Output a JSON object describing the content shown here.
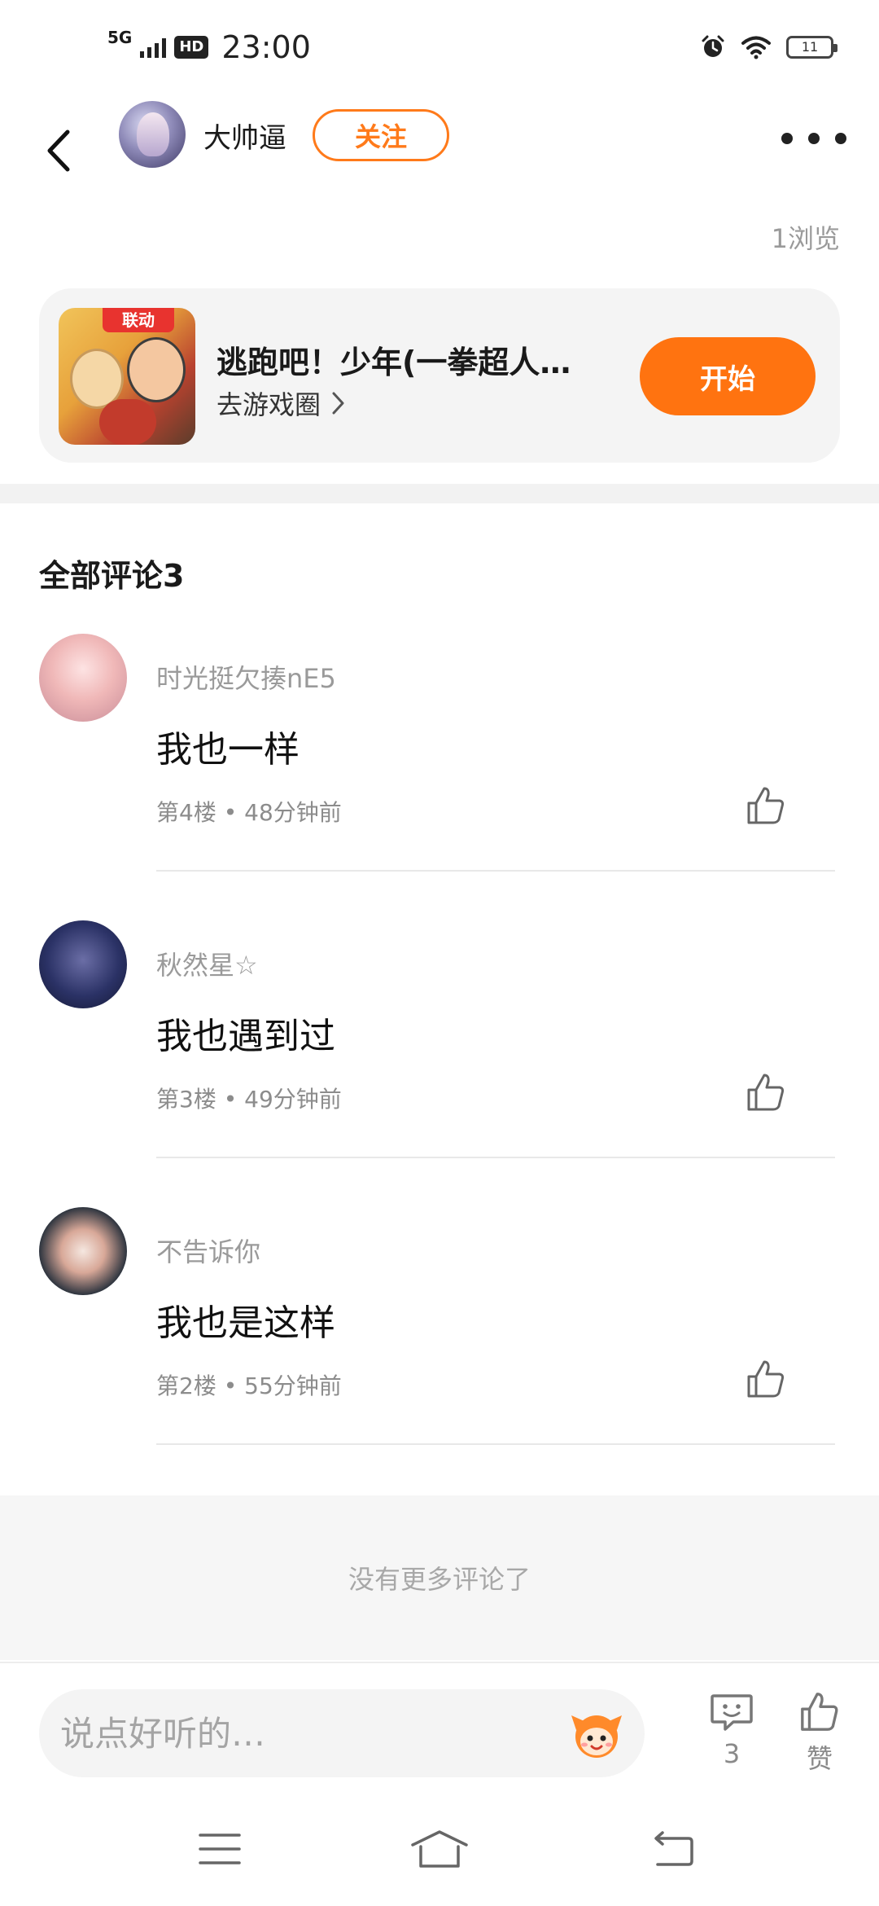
{
  "status_bar": {
    "network": "5G",
    "hd": "HD",
    "time": "23:00",
    "battery": "11"
  },
  "header": {
    "username": "大帅逼",
    "follow_label": "关注",
    "views": "1浏览"
  },
  "game_card": {
    "thumb_tag": "联动",
    "title": "逃跑吧！少年(一拳超人…",
    "subtitle": "去游戏圈",
    "start_label": "开始"
  },
  "comments_section": {
    "title": "全部评论3",
    "items": [
      {
        "name": "时光挺欠揍nE5",
        "text": "我也一样",
        "meta": "第4楼 • 48分钟前"
      },
      {
        "name": "秋然星☆",
        "text": "我也遇到过",
        "meta": "第3楼 • 49分钟前"
      },
      {
        "name": "不告诉你",
        "text": "我也是这样",
        "meta": "第2楼 • 55分钟前"
      }
    ],
    "no_more": "没有更多评论了"
  },
  "bottom_bar": {
    "placeholder": "说点好听的…",
    "comment_count": "3",
    "like_label": "赞"
  },
  "colors": {
    "accent": "#ff7310",
    "follow": "#ff7a1a",
    "muted": "#9a9a9a"
  }
}
